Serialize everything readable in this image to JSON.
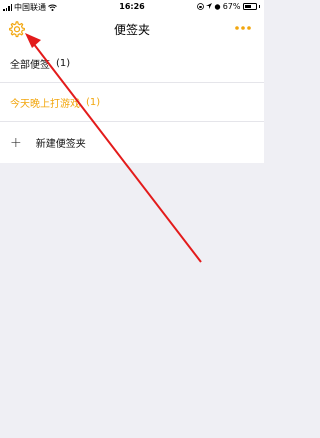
{
  "status_bar": {
    "carrier": "中国联通",
    "time": "16:26",
    "battery": "67%",
    "battery_level": 0.67
  },
  "nav": {
    "title": "便签夹",
    "settings_icon": "gear-icon",
    "more_icon": "ellipsis-icon"
  },
  "folders": [
    {
      "label": "全部便签",
      "count": "(1)"
    },
    {
      "label": "今天晚上打游戏",
      "count": "(1)"
    }
  ],
  "new_folder": {
    "plus": "+",
    "label": "新建便签夹"
  },
  "colors": {
    "accent": "#f2a60d",
    "annotation_arrow": "#e31b1b",
    "background": "#efeff4"
  }
}
